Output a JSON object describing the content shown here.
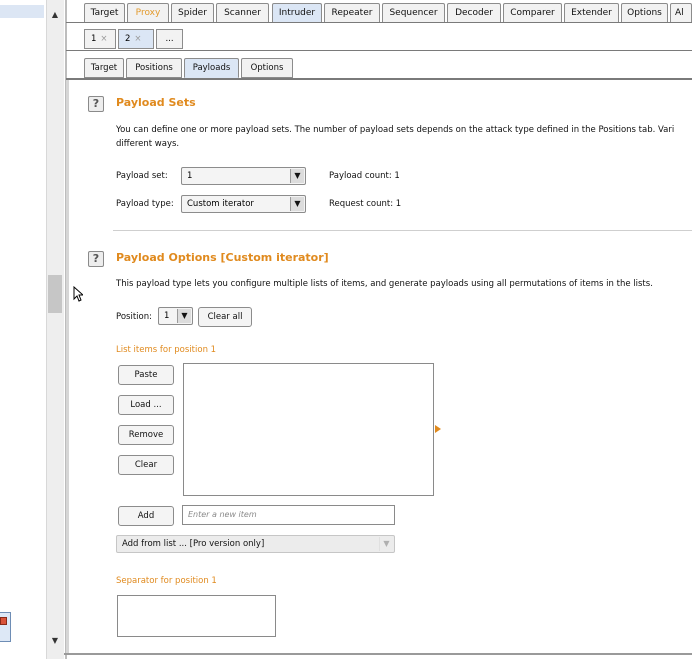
{
  "main_tabs": [
    "Target",
    "Proxy",
    "Spider",
    "Scanner",
    "Intruder",
    "Repeater",
    "Sequencer",
    "Decoder",
    "Comparer",
    "Extender",
    "Options",
    "Al"
  ],
  "request_tabs": [
    {
      "label": "1",
      "close": "×"
    },
    {
      "label": "2",
      "close": "×"
    },
    {
      "label": "..."
    }
  ],
  "sub_tabs": [
    "Target",
    "Positions",
    "Payloads",
    "Options"
  ],
  "payload_sets": {
    "title": "Payload Sets",
    "help": "?",
    "description_line1": "You can define one or more payload sets. The number of payload sets depends on the attack type defined in the Positions tab. Vari",
    "description_line2": "different ways.",
    "payload_set_label": "Payload set:",
    "payload_set_value": "1",
    "payload_type_label": "Payload type:",
    "payload_type_value": "Custom iterator",
    "payload_count_label": "Payload count:",
    "payload_count_value": "1",
    "request_count_label": "Request count:",
    "request_count_value": "1"
  },
  "payload_options": {
    "title": "Payload Options [Custom iterator]",
    "help": "?",
    "description": "This payload type lets you configure multiple lists of items, and generate payloads using all permutations of items in the lists.",
    "position_label": "Position:",
    "position_value": "1",
    "clear_all_label": "Clear all",
    "list_items_label": "List items for position 1",
    "paste_label": "Paste",
    "load_label": "Load ...",
    "remove_label": "Remove",
    "clear_label": "Clear",
    "add_label": "Add",
    "new_item_placeholder": "Enter a new item",
    "add_from_list_value": "Add from list ... [Pro version only]",
    "separator_label": "Separator for position 1"
  },
  "icons": {
    "dropdown_arrow": "▼",
    "scroll_up": "▲",
    "scroll_down": "▼"
  },
  "colors": {
    "accent_orange": "#e08a1e",
    "selected_tab": "#dbe6f5"
  }
}
